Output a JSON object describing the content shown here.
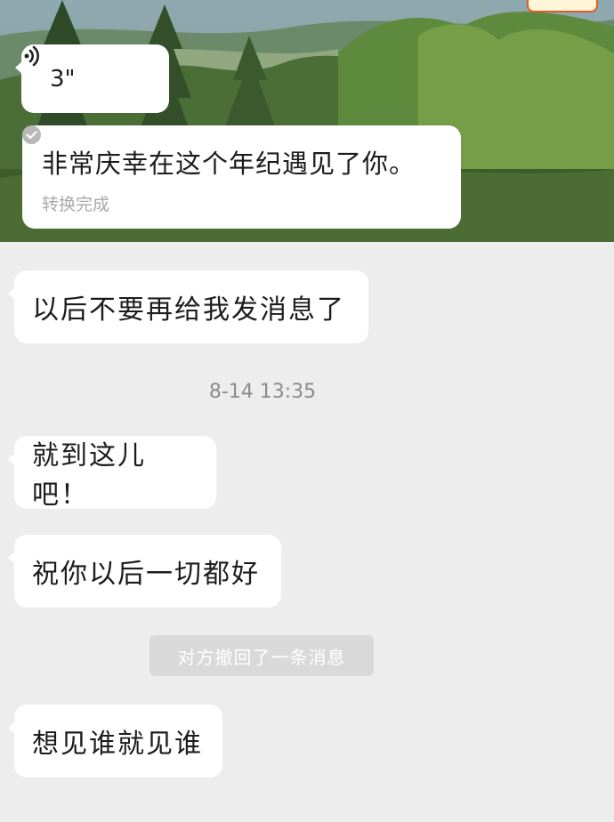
{
  "voice_message": {
    "duration": "3\"",
    "transcript": "非常庆幸在这个年纪遇见了你。",
    "status": "转换完成"
  },
  "messages": [
    {
      "text": "以后不要再给我发消息了"
    },
    {
      "text": "就到这儿吧！"
    },
    {
      "text": "祝你以后一切都好"
    },
    {
      "text": "想见谁就见谁"
    }
  ],
  "timestamp": "8-14 13:35",
  "system_note": "对方撤回了一条消息",
  "icons": [
    "voice-wave-icon",
    "check-circle-icon"
  ],
  "colors": {
    "background": "#ededed",
    "bubble": "#ffffff",
    "system_note_bg": "#d9d9d9"
  }
}
